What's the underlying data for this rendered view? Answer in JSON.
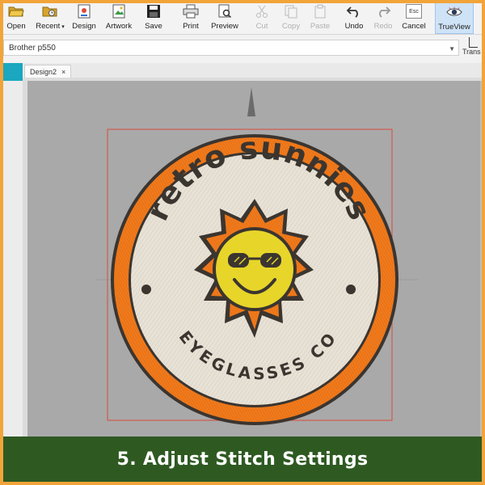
{
  "toolbar": {
    "buttons": [
      {
        "label": "Open",
        "icon": "folder-open-icon",
        "enabled": true
      },
      {
        "label": "Recent",
        "icon": "recent-folder-icon",
        "enabled": true,
        "dropdown": true
      },
      {
        "label": "Design",
        "icon": "design-icon",
        "enabled": true
      },
      {
        "label": "Artwork",
        "icon": "artwork-icon",
        "enabled": true
      },
      {
        "label": "Save",
        "icon": "save-icon",
        "enabled": true
      },
      {
        "label": "Print",
        "icon": "print-icon",
        "enabled": true
      },
      {
        "label": "Preview",
        "icon": "preview-icon",
        "enabled": true
      },
      {
        "label": "Cut",
        "icon": "cut-icon",
        "enabled": false
      },
      {
        "label": "Copy",
        "icon": "copy-icon",
        "enabled": false
      },
      {
        "label": "Paste",
        "icon": "paste-icon",
        "enabled": false
      },
      {
        "label": "Undo",
        "icon": "undo-icon",
        "enabled": true
      },
      {
        "label": "Redo",
        "icon": "redo-icon",
        "enabled": false
      },
      {
        "label": "Cancel",
        "icon": "escape-icon",
        "enabled": true,
        "key": "Esc"
      },
      {
        "label": "TrueView",
        "icon": "eye-icon",
        "enabled": true,
        "active": true
      }
    ]
  },
  "printer": {
    "selected": "Brother p550"
  },
  "trans_label": "Trans",
  "tab": {
    "label": "Design2",
    "close": "×"
  },
  "design": {
    "top_text": "retro sunnies",
    "bottom_text": "EYEGLASSES CO",
    "colors": {
      "orange": "#f07a1c",
      "cream": "#e8e2d6",
      "yellow": "#e7d52a",
      "dark": "#3b3530",
      "outline": "#d94a3a"
    }
  },
  "banner": {
    "text": "5. Adjust Stitch Settings",
    "color": "#2e5a22"
  },
  "accent": "#f2a43a"
}
